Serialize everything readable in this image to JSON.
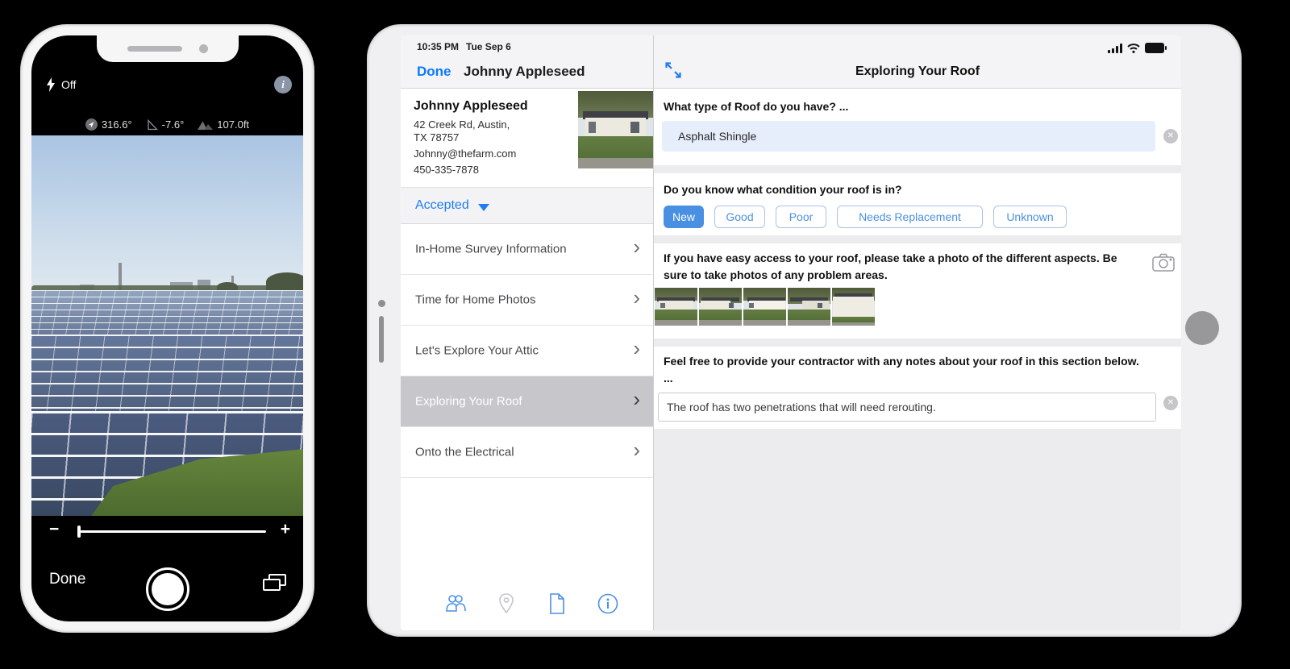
{
  "phone": {
    "flash": {
      "label": "Off"
    },
    "compass": {
      "heading": "316.6°",
      "tilt": "-7.6°",
      "elevation": "107.0ft"
    },
    "controls": {
      "done_label": "Done",
      "zoom_out": "−",
      "zoom_in": "+"
    }
  },
  "tablet": {
    "status_bar": {
      "time": "10:35 PM",
      "date": "Tue Sep 6"
    },
    "left_panel": {
      "done_label": "Done",
      "nav_title": "Johnny Appleseed",
      "contact": {
        "name": "Johnny Appleseed",
        "address_line1": "42 Creek Rd, Austin,",
        "address_line2": "TX 78757",
        "email": "Johnny@thefarm.com",
        "phone": "450-335-7878"
      },
      "status_dropdown_label": "Accepted",
      "sections": [
        {
          "label": "In-Home Survey Information"
        },
        {
          "label": "Time for Home Photos"
        },
        {
          "label": "Let's Explore Your Attic"
        },
        {
          "label": "Exploring Your Roof"
        },
        {
          "label": "Onto the Electrical"
        }
      ],
      "toolbar_icons": [
        "contacts-icon",
        "location-pin-icon",
        "document-icon",
        "info-icon"
      ]
    },
    "right_panel": {
      "title": "Exploring Your Roof",
      "roof_type": {
        "label": "What type of Roof do you have?  ...",
        "value": "Asphalt Shingle"
      },
      "condition": {
        "label": "Do you know what condition your roof is in?",
        "options": [
          "New",
          "Good",
          "Poor",
          "Needs Replacement",
          "Unknown"
        ],
        "selected": "New"
      },
      "photos": {
        "label": "If you have easy access to your roof, please take a photo of the different aspects. Be sure to take photos of any problem areas.",
        "count": 5
      },
      "notes": {
        "label": "Feel free to provide your contractor with any notes about your roof in this section below.  ...",
        "value": "The roof has two penetrations that will need rerouting."
      }
    }
  },
  "colors": {
    "accent_blue": "#0a7aff",
    "button_blue": "#4a90e2",
    "selected_row_gray": "#c7c7cb",
    "input_highlight": "#e7eefb",
    "panel_gray": "#ececef"
  }
}
